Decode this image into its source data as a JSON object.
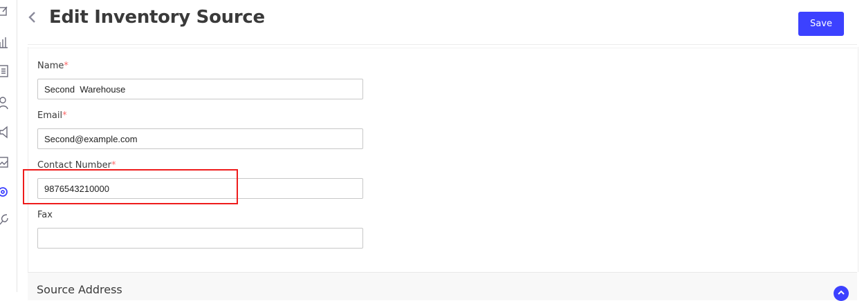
{
  "header": {
    "title": "Edit Inventory Source",
    "save_label": "Save"
  },
  "sidebar": {
    "icons": [
      "edit-icon",
      "chart-icon",
      "document-icon",
      "user-icon",
      "megaphone-icon",
      "image-icon",
      "settings-icon",
      "tools-icon"
    ]
  },
  "form": {
    "required_mark": "*",
    "name": {
      "label": "Name",
      "value": "Second  Warehouse"
    },
    "email": {
      "label": "Email",
      "value": "Second@example.com"
    },
    "contact": {
      "label": "Contact Number",
      "value": "9876543210000"
    },
    "fax": {
      "label": "Fax",
      "value": ""
    }
  },
  "accordion": {
    "title": "Source Address"
  },
  "colors": {
    "primary": "#3c41ff",
    "required": "#fc6868",
    "highlight": "#ee1b1b"
  }
}
